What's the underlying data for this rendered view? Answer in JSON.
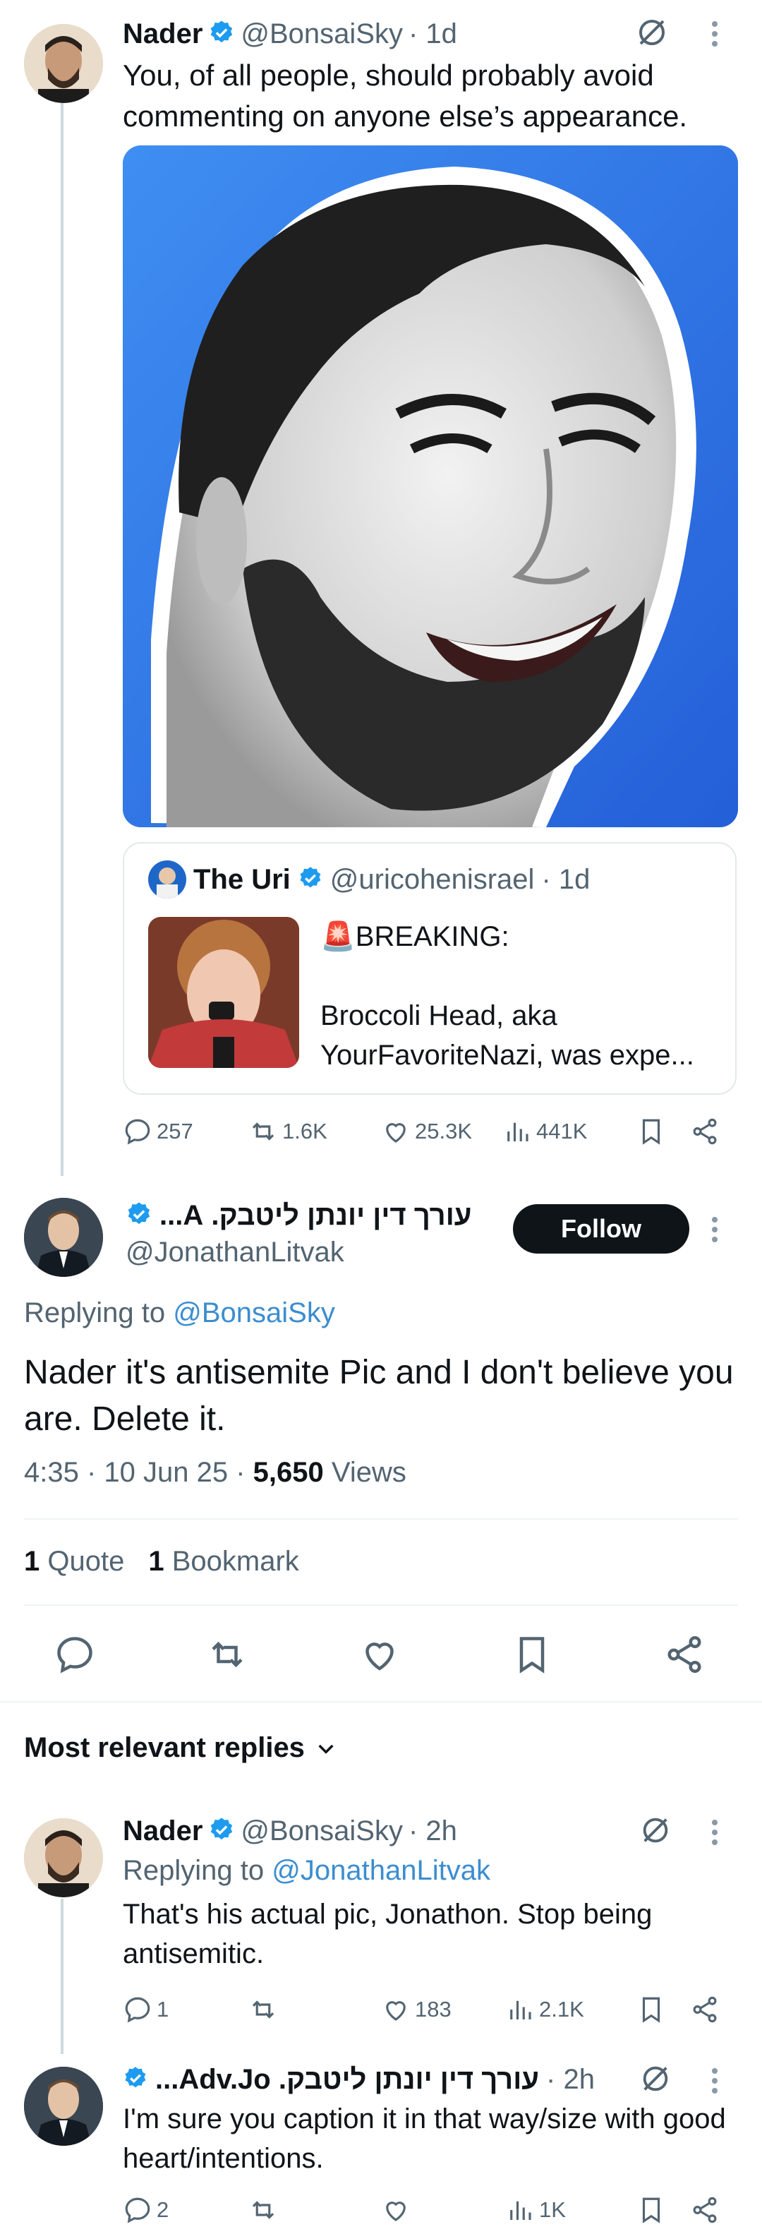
{
  "quoted_post": {
    "author_name": "Nader",
    "handle": "@BonsaiSky",
    "time": "· 1d",
    "text": "You, of all people, should probably avoid commenting on anyone else’s appearance.",
    "embedded": {
      "author_name": "The Uri",
      "handle": "@uricohenisrael",
      "time": "· 1d",
      "line1": "🚨BREAKING:",
      "line2": "Broccoli Head, aka",
      "line3": "YourFavoriteNazi, was expe..."
    },
    "stats": {
      "replies": "257",
      "reposts": "1.6K",
      "likes": "25.3K",
      "views": "441K"
    }
  },
  "main_post": {
    "author_name": "עורך דין יונתן ליטבק. A...",
    "handle": "@JonathanLitvak",
    "follow_label": "Follow",
    "replying_label": "Replying to",
    "replying_handle": "@BonsaiSky",
    "text": "Nader it's antisemite Pic and I don't believe you are. Delete it.",
    "time_date": "4:35 · 10 Jun 25 ·",
    "views_count": "5,650",
    "views_label": "Views",
    "quote_count": "1",
    "quote_label": "Quote",
    "bookmark_count": "1",
    "bookmark_label": "Bookmark"
  },
  "replies_header": "Most relevant replies",
  "replies": [
    {
      "author_name": "Nader",
      "handle": "@BonsaiSky",
      "time": "· 2h",
      "replying_label": "Replying to",
      "replying_handle": "@JonathanLitvak",
      "text": "That's his actual pic, Jonathon. Stop being antisemitic.",
      "stats": {
        "replies": "1",
        "reposts": "",
        "likes": "183",
        "views": "2.1K"
      }
    },
    {
      "author_name": "עורך דין יונתן ליטבק. Adv.Jo...",
      "time": "· 2h",
      "text": "I'm sure you caption it in that way/size with good heart/intentions.",
      "stats": {
        "replies": "2",
        "reposts": "",
        "likes": "",
        "views": "1K"
      }
    }
  ],
  "colors": {
    "accent": "#1d9bf0",
    "link": "#3b8dd0",
    "text": "#0f1419",
    "muted": "#536471",
    "photo_bg": "#2f74e6"
  }
}
